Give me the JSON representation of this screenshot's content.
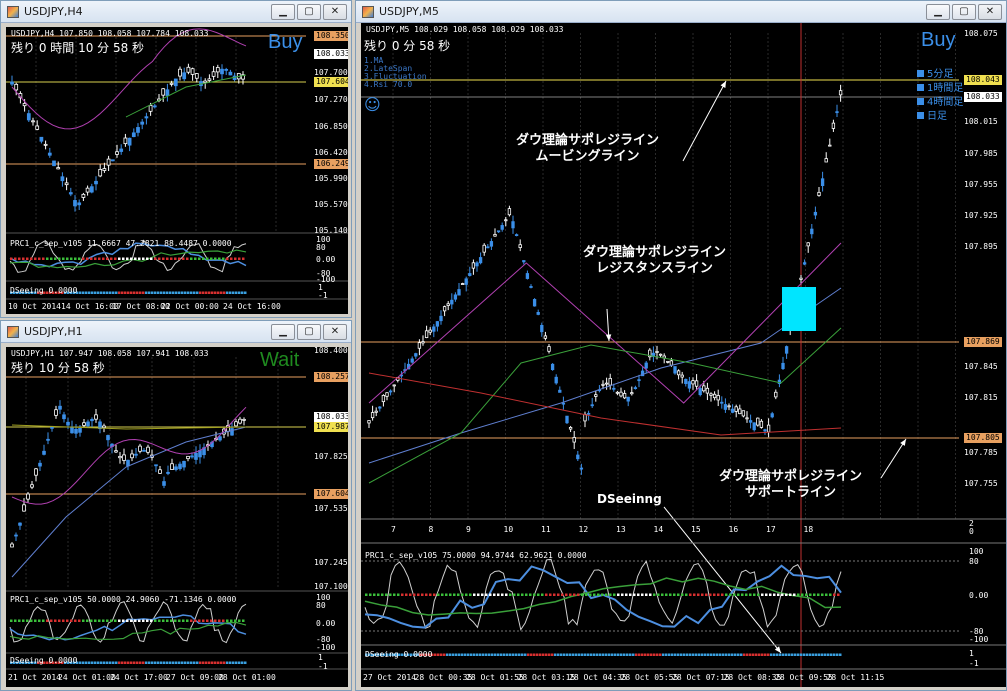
{
  "windows": {
    "h4": {
      "title": "USDJPY,H4",
      "ohlc": "USDJPY,H4  107.850 108.058 107.784 108.033",
      "remaining": "残り 0 時間 10 分 58 秒",
      "signal": "Buy",
      "signal_color": "#3b8fe8",
      "price_labels": [
        "108.350",
        "108.033",
        "107.700",
        "107.604",
        "107.270",
        "106.850",
        "106.420",
        "106.249",
        "105.990",
        "105.570",
        "105.140"
      ],
      "osc_label": "PRC1_c_sep_v105 11.6667 47.2821 88.4487 0.0000",
      "osc_scale": [
        "100",
        "80",
        "0.00",
        "-80",
        "-100"
      ],
      "dseeing_label": "DSeeing 0.0000",
      "dseeing_scale": [
        "1",
        "-1"
      ],
      "time_labels": [
        "10 Oct 2014",
        "14 Oct 16:00",
        "17 Oct 08:00",
        "22 Oct 00:00",
        "24 Oct 16:00"
      ]
    },
    "h1": {
      "title": "USDJPY,H1",
      "ohlc": "USDJPY,H1  107.947 108.058 107.941 108.033",
      "remaining": "残り 10 分 58 秒",
      "signal": "Wait",
      "signal_color": "#1f8a1f",
      "price_labels": [
        "108.400",
        "108.257",
        "108.033",
        "107.987",
        "107.825",
        "107.604",
        "107.535",
        "107.245",
        "107.100"
      ],
      "osc_label": "PRC1_c_sep_v105 50.0000 24.9060 -71.1346 0.0000",
      "osc_scale": [
        "100",
        "80",
        "0.00",
        "-80",
        "-100"
      ],
      "dseeing_label": "DSeeing 0.0000",
      "dseeing_scale": [
        "1",
        "-1"
      ],
      "time_labels": [
        "21 Oct 2014",
        "24 Oct 01:00",
        "24 Oct 17:00",
        "27 Oct 09:00",
        "28 Oct 01:00"
      ]
    },
    "m5": {
      "title": "USDJPY,M5",
      "ohlc": "USDJPY,M5  108.029 108.058 108.029 108.033",
      "remaining": "残り 0 分 58 秒",
      "signal": "Buy",
      "signal_color": "#3b8fe8",
      "legend": [
        "1.MA",
        "2.LateSpan",
        "3.Fluctuation",
        "4.Rsi 70.0"
      ],
      "timeframes": [
        "5分足",
        "1時間足",
        "4時間足",
        "日足"
      ],
      "price_labels": [
        "108.075",
        "108.043",
        "108.033",
        "108.015",
        "107.985",
        "107.955",
        "107.925",
        "107.895",
        "107.869",
        "107.845",
        "107.815",
        "107.805",
        "107.785",
        "107.755"
      ],
      "hours": [
        "7",
        "8",
        "9",
        "10",
        "11",
        "12",
        "13",
        "14",
        "15",
        "16",
        "17",
        "18"
      ],
      "osc_label": "PRC1_c_sep_v105 75.0000 94.9744 62.9621 0.0000",
      "osc_scale": [
        "2",
        "0",
        "100",
        "80",
        "0.00",
        "-80",
        "-100"
      ],
      "dseeing_label": "DSeeing 0.0000",
      "dseeing_scale": [
        "1",
        "-1"
      ],
      "time_labels": [
        "27 Oct 2014",
        "28 Oct 00:35",
        "28 Oct 01:55",
        "28 Oct 03:15",
        "28 Oct 04:35",
        "28 Oct 05:55",
        "28 Oct 07:15",
        "28 Oct 08:35",
        "28 Oct 09:55",
        "28 Oct 11:15"
      ],
      "annotations": {
        "ma": [
          "ダウ理論サポレジライン",
          "ムービングライン"
        ],
        "resistance": [
          "ダウ理論サポレジライン",
          "レジスタンスライン"
        ],
        "support": [
          "ダウ理論サポレジライン",
          "サポートライン"
        ],
        "dseeing": "DSeeinng"
      }
    }
  },
  "colors": {
    "up_candle": "#3b8fe8",
    "down_candle": "#ffffff",
    "resistance_line": "#e8a060",
    "support_line": "#e8a060",
    "highlight_box": "#00e5ff",
    "ma_purple": "#b040b0",
    "ma_green": "#3aa03a",
    "ma_red": "#c03030",
    "trend_blue": "#5f7fd0"
  }
}
